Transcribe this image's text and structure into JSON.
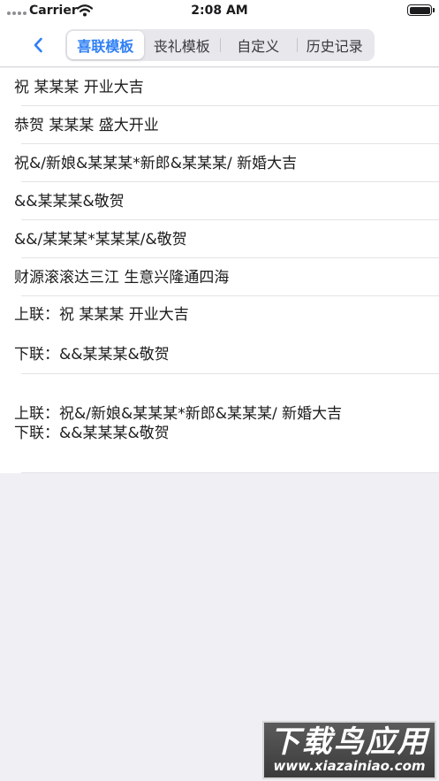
{
  "status_bar": {
    "carrier": "Carrier",
    "time": "2:08 AM"
  },
  "nav": {
    "back_icon": "chevron-left-icon",
    "accent_color": "#2f7ff5",
    "tabs": [
      {
        "label": "喜联模板",
        "selected": true
      },
      {
        "label": "丧礼模板",
        "selected": false
      },
      {
        "label": "自定义",
        "selected": false
      },
      {
        "label": "历史记录",
        "selected": false
      }
    ]
  },
  "templates": [
    "祝 某某某 开业大吉",
    "恭贺 某某某 盛大开业",
    "祝&/新娘&某某某*新郎&某某某/ 新婚大吉",
    "&&某某某&敬贺",
    "&&/某某某*某某某/&敬贺",
    "财源滚滚达三江 生意兴隆通四海",
    "上联：祝 某某某 开业大吉\n下联：&&某某某&敬贺",
    "上联：祝&/新娘&某某某*新郎&某某某/ 新婚大吉\n下联：&&某某某&敬贺"
  ],
  "watermark": {
    "title": "下载鸟应用",
    "url": "www.xiazainiao.com"
  }
}
